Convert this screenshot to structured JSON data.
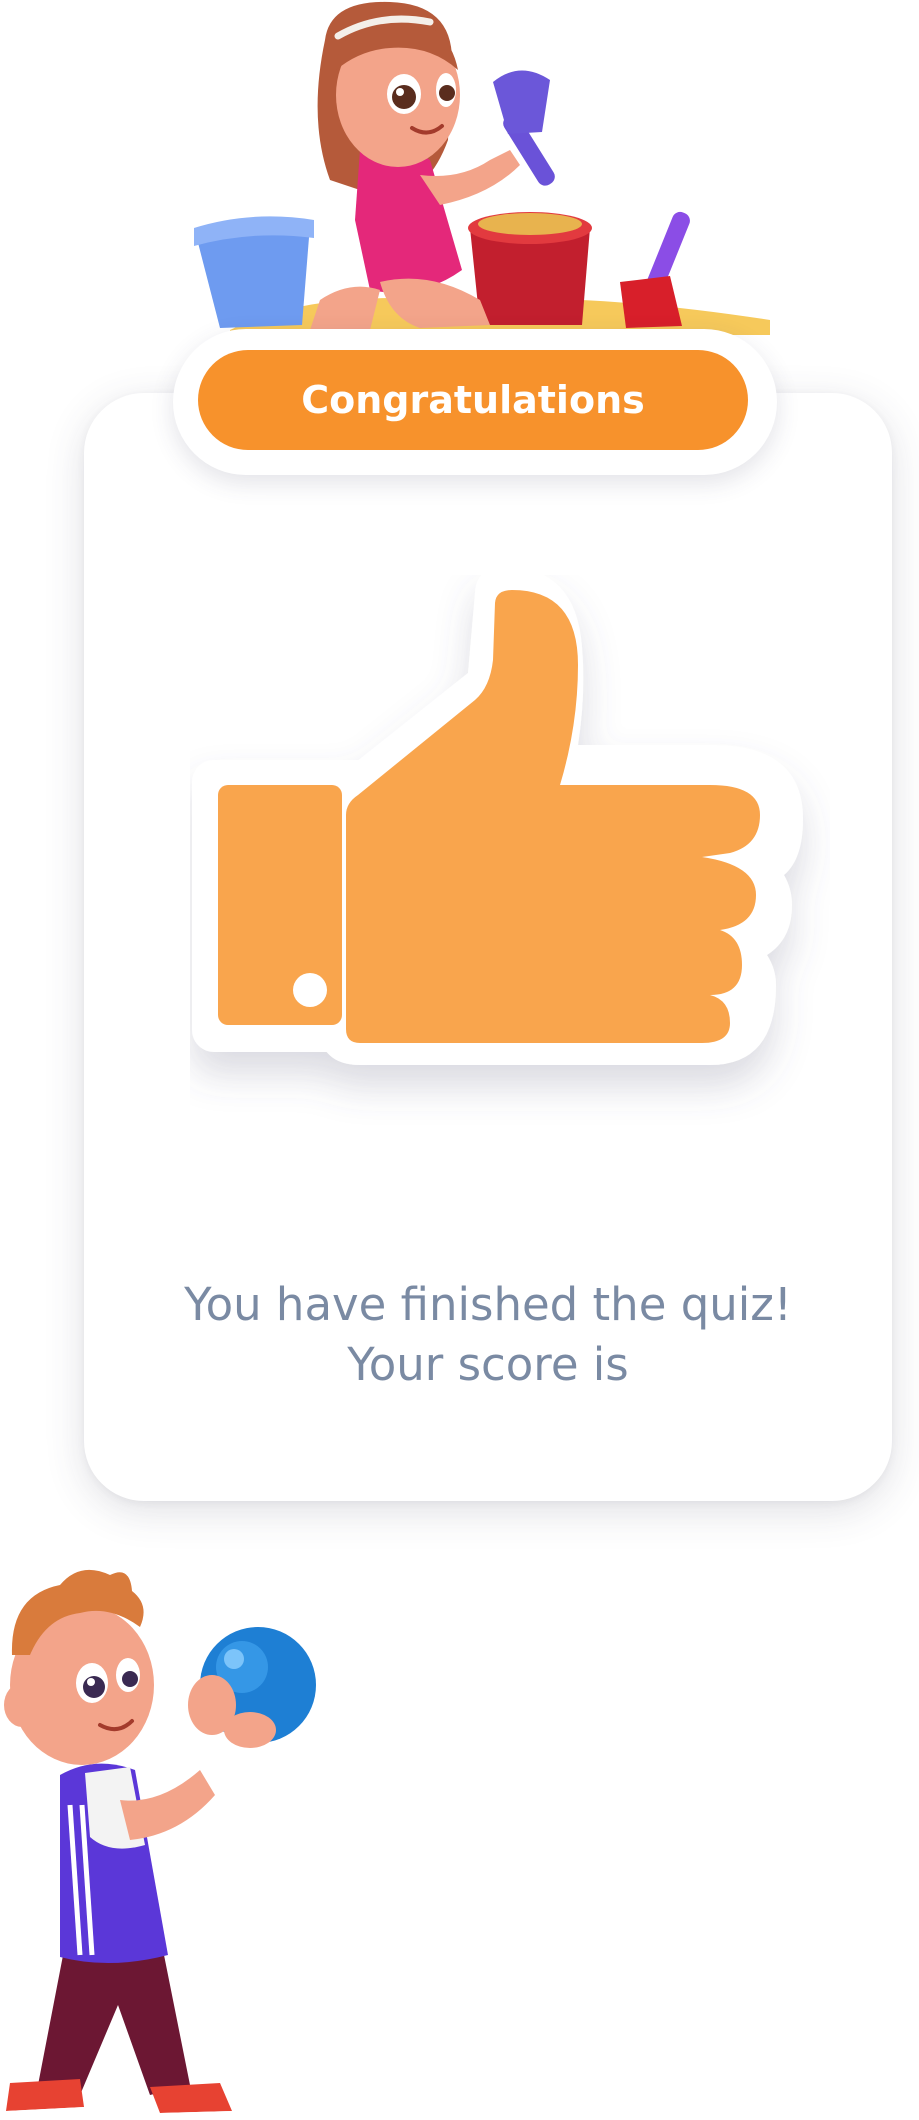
{
  "banner": {
    "label": "Congratulations"
  },
  "result": {
    "line1": "You have finished the quiz!",
    "line2": "Your score is"
  },
  "icons": {
    "hero": "thumbs-up-icon",
    "top_illustration": "girl-playing-sand-illustration",
    "bottom_illustration": "boy-holding-ball-illustration"
  },
  "colors": {
    "accent": "#f7922c",
    "thumb": "#f9a54d",
    "message_text": "#7a8aa3",
    "card_background": "#ffffff"
  }
}
